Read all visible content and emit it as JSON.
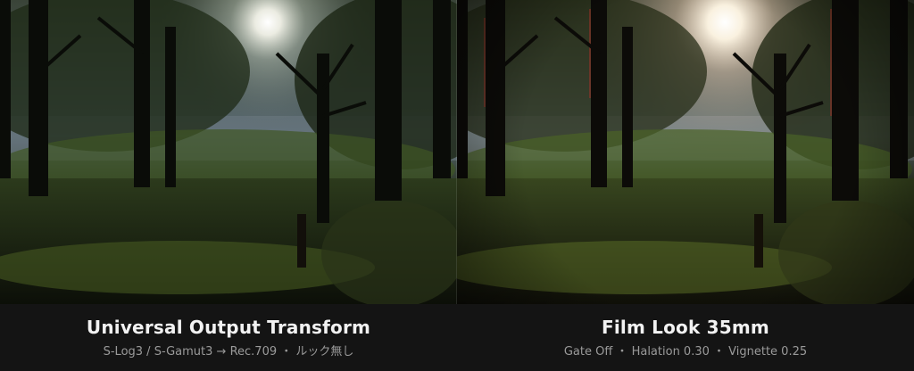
{
  "comparison": {
    "left": {
      "title": "Universal Output Transform",
      "subtitle": "S-Log3 / S-Gamut3 → Rec.709 ・ ルック無し"
    },
    "right": {
      "title": "Film Look 35mm",
      "subtitle": "Gate Off ・ Halation 0.30 ・ Vignette 0.25"
    }
  },
  "colors": {
    "caption_bar": "#141414",
    "title_text": "#f2f2f2",
    "subtitle_text": "#9a9a9a"
  }
}
